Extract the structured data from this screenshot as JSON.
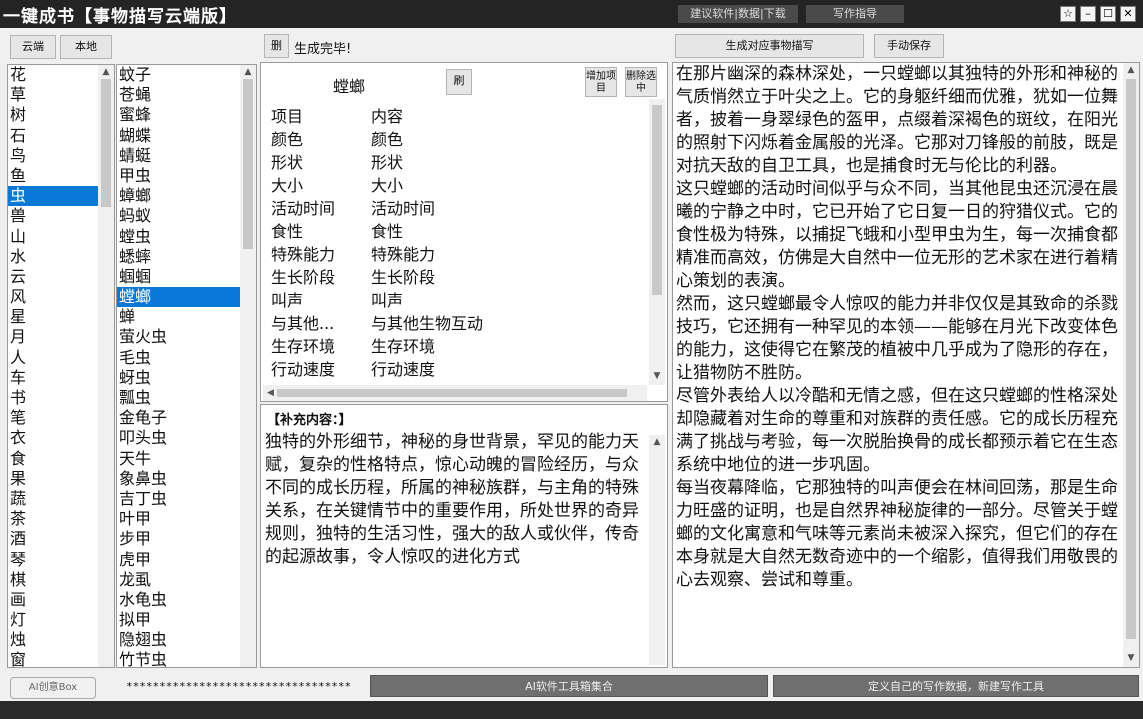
{
  "window": {
    "title": "一键成书【事物描写云端版】",
    "links": [
      "建议软件|数据|下载",
      "写作指导"
    ],
    "controls": [
      "☆",
      "–",
      "☐",
      "✕"
    ]
  },
  "toolbar": {
    "cloud_tab": "云端",
    "local_tab": "本地",
    "mini_btn": "删",
    "status_msg": "生成完毕!",
    "generate_btn": "生成对应事物描写",
    "save_btn": "手动保存"
  },
  "categories": [
    "花",
    "草",
    "树",
    "石",
    "鸟",
    "鱼",
    "虫",
    "兽",
    "山",
    "水",
    "云",
    "风",
    "星",
    "月",
    "人",
    "车",
    "书",
    "笔",
    "衣",
    "食",
    "果",
    "蔬",
    "茶",
    "酒",
    "琴",
    "棋",
    "画",
    "灯",
    "烛",
    "窗"
  ],
  "selected_category": "虫",
  "items": [
    "蚊子",
    "苍蝇",
    "蜜蜂",
    "蝴蝶",
    "蜻蜓",
    "甲虫",
    "蟑螂",
    "蚂蚁",
    "螳虫",
    "蟋蟀",
    "蝈蝈",
    "螳螂",
    "蝉",
    "萤火虫",
    "毛虫",
    "蚜虫",
    "瓢虫",
    "金龟子",
    "叩头虫",
    "天牛",
    "象鼻虫",
    "吉丁虫",
    "叶甲",
    "步甲",
    "虎甲",
    "龙虱",
    "水龟虫",
    "拟甲",
    "隐翅虫",
    "竹节虫"
  ],
  "selected_item": "螳螂",
  "attributes": {
    "subject": "螳螂",
    "refresh_btn": "刷",
    "add_btn": "增加项目",
    "delete_btn": "删除选中",
    "rows": [
      {
        "key": "项目",
        "value": "内容"
      },
      {
        "key": "颜色",
        "value": "颜色"
      },
      {
        "key": "形状",
        "value": "形状"
      },
      {
        "key": "大小",
        "value": "大小"
      },
      {
        "key": "活动时间",
        "value": "活动时间"
      },
      {
        "key": "食性",
        "value": "食性"
      },
      {
        "key": "特殊能力",
        "value": "特殊能力"
      },
      {
        "key": "生长阶段",
        "value": "生长阶段"
      },
      {
        "key": "叫声",
        "value": "叫声"
      },
      {
        "key": "与其他...",
        "value": "与其他生物互动"
      },
      {
        "key": "生存环境",
        "value": "生存环境"
      },
      {
        "key": "行动速度",
        "value": "行动速度"
      }
    ]
  },
  "supplement": {
    "label": "【补充内容：】",
    "text": "独特的外形细节，神秘的身世背景，罕见的能力天赋，复杂的性格特点，惊心动魄的冒险经历，与众不同的成长历程，所属的神秘族群，与主角的特殊关系，在关键情节中的重要作用，所处世界的奇异规则，独特的生活习性，强大的敌人或伙伴，传奇的起源故事，令人惊叹的进化方式"
  },
  "output": {
    "paragraphs": [
      "在那片幽深的森林深处，一只螳螂以其独特的外形和神秘的气质悄然立于叶尖之上。它的身躯纤细而优雅，犹如一位舞者，披着一身翠绿色的盔甲，点缀着深褐色的斑纹，在阳光的照射下闪烁着金属般的光泽。它那对刀锋般的前肢，既是对抗天敌的自卫工具，也是捕食时无与伦比的利器。",
      "这只螳螂的活动时间似乎与众不同，当其他昆虫还沉浸在晨曦的宁静之中时，它已开始了它日复一日的狩猎仪式。它的食性极为特殊，以捕捉飞蛾和小型甲虫为生，每一次捕食都精准而高效，仿佛是大自然中一位无形的艺术家在进行着精心策划的表演。",
      "然而，这只螳螂最令人惊叹的能力并非仅仅是其致命的杀戮技巧，它还拥有一种罕见的本领——能够在月光下改变体色的能力，这使得它在繁茂的植被中几乎成为了隐形的存在，让猎物防不胜防。",
      "尽管外表给人以冷酷和无情之感，但在这只螳螂的性格深处却隐藏着对生命的尊重和对族群的责任感。它的成长历程充满了挑战与考验，每一次脱胎换骨的成长都预示着它在生态系统中地位的进一步巩固。",
      "每当夜幕降临，它那独特的叫声便会在林间回荡，那是生命力旺盛的证明，也是自然界神秘旋律的一部分。尽管关于螳螂的文化寓意和气味等元素尚未被深入探究，但它们的存在本身就是大自然无数奇迹中的一个缩影，值得我们用敬畏的心去观察、尝试和尊重。"
    ]
  },
  "footer": {
    "logo_text": "AI创意Box",
    "password_mask": "**********************************",
    "center_btn": "AI软件工具箱集合",
    "right_btn": "定义自己的写作数据，新建写作工具"
  }
}
